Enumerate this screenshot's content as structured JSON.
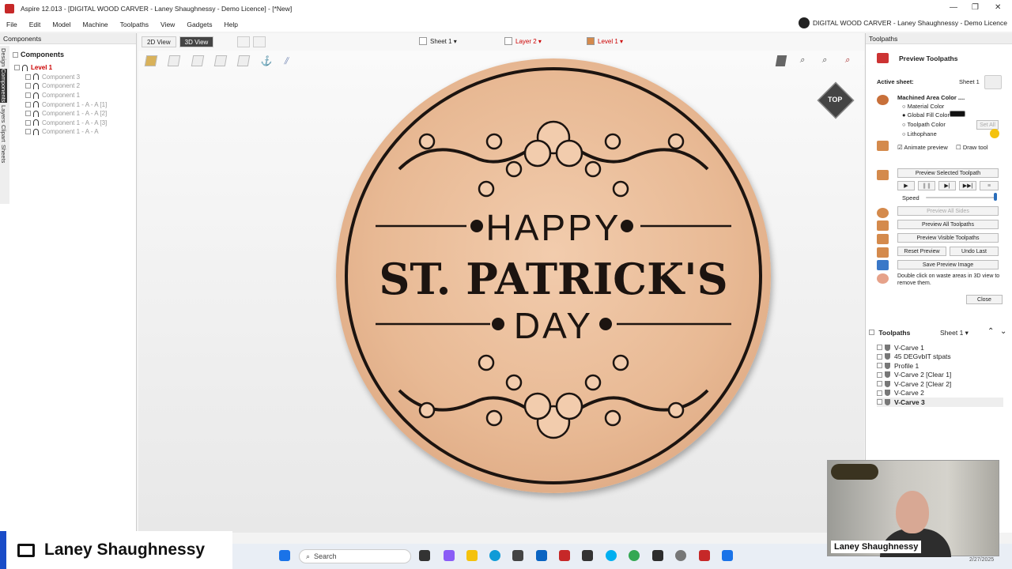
{
  "window": {
    "title": "Aspire 12.013 - [DIGITAL WOOD CARVER - Laney Shaughnessy - Demo Licence] - [*New]"
  },
  "menu": [
    "File",
    "Edit",
    "Model",
    "Machine",
    "Toolpaths",
    "View",
    "Gadgets",
    "Help"
  ],
  "license_right": "DIGITAL WOOD CARVER - Laney Shaughnessy - Demo Licence",
  "left_panel": {
    "header": "Components",
    "vertical_tabs": [
      "Design",
      "Components",
      "Layers",
      "Clipart",
      "Sheets"
    ],
    "title": "Components",
    "level": "Level 1",
    "items": [
      "Component 3",
      "Component 2",
      "Component 1",
      "Component 1 - A - A [1]",
      "Component 1 - A - A [2]",
      "Component 1 - A - A [3]",
      "Component 1 - A - A"
    ]
  },
  "view_toolbar": {
    "view2d": "2D View",
    "view3d": "3D View",
    "sheet": "Sheet 1",
    "layer": "Layer 2",
    "level": "Level 1"
  },
  "sign": {
    "line1": "HAPPY",
    "line2": "ST. PATRICK'S",
    "line3": "DAY"
  },
  "view_cube": "TOP",
  "right_panel": {
    "header": "Toolpaths",
    "title": "Preview Toolpaths",
    "active_sheet_label": "Active sheet:",
    "active_sheet_value": "Sheet 1",
    "machined_area": "Machined Area Color ....",
    "material_color": "Material Color",
    "global_fill": "Global Fill Color",
    "toolpath_color": "Toolpath Color",
    "set_all": "Set All",
    "lithophane": "Lithophane",
    "animate_preview": "Animate preview",
    "draw_tool": "Draw tool",
    "preview_selected": "Preview Selected Toolpath",
    "speed": "Speed",
    "preview_all_sides": "Preview All Sides",
    "preview_all": "Preview All Toolpaths",
    "preview_visible": "Preview Visible Toolpaths",
    "reset_preview": "Reset Preview",
    "undo_last": "Undo Last",
    "save_image": "Save Preview Image",
    "hint": "Double click on waste areas in 3D view to remove them.",
    "close": "Close",
    "toolpaths_label": "Toolpaths",
    "toolpaths_sheet": "Sheet 1",
    "toolpaths": [
      "V-Carve 1",
      "45 DEGvbIT stpats",
      "Profile 1",
      "V-Carve 2 [Clear 1]",
      "V-Carve 2 [Clear 2]",
      "V-Carve 2",
      "V-Carve 3"
    ]
  },
  "taskbar": {
    "search": "Search",
    "date": "2/27/2025"
  },
  "overlay": {
    "name": "Laney Shaughnessy",
    "webcam_name": "Laney Shaughnessy"
  }
}
